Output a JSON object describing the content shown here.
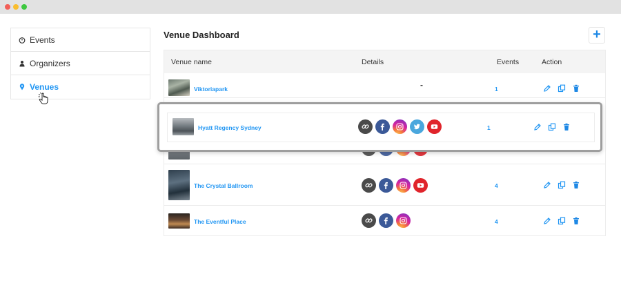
{
  "window": {
    "title": ""
  },
  "sidebar": {
    "items": [
      {
        "label": "Events",
        "icon": "gauge-icon",
        "active": false
      },
      {
        "label": "Organizers",
        "icon": "user-icon",
        "active": false
      },
      {
        "label": "Venues",
        "icon": "location-pin-icon",
        "active": true
      }
    ]
  },
  "header": {
    "title": "Venue Dashboard",
    "add_label": "+"
  },
  "table": {
    "columns": [
      "Venue name",
      "Details",
      "Events",
      "Action"
    ],
    "rows": [
      {
        "name": "Viktoriapark",
        "details": "-",
        "socials": [],
        "events": "1"
      },
      {
        "name": "Hyatt Regency Sydney",
        "socials": [
          "link",
          "facebook",
          "instagram",
          "twitter",
          "youtube"
        ],
        "events": "1"
      },
      {
        "name": "The Crystal Ballroom",
        "socials": [
          "link",
          "facebook",
          "instagram",
          "youtube"
        ],
        "events": "4"
      },
      {
        "name": "The Eventful Place",
        "socials": [
          "link",
          "facebook",
          "instagram"
        ],
        "events": "4"
      }
    ],
    "action_icons": [
      "edit-icon",
      "duplicate-icon",
      "delete-icon"
    ]
  },
  "colors": {
    "accent": "#2196f3",
    "link": "#4a4a4a",
    "facebook": "#3b5998",
    "twitter": "#4aa7dd",
    "youtube": "#e0242b"
  }
}
